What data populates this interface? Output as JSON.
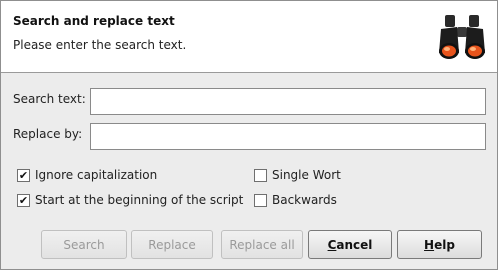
{
  "dialog": {
    "title": "Search and replace text",
    "subtitle": "Please enter the search text.",
    "header_icon": "binoculars-icon"
  },
  "form": {
    "search_label": "Search text:",
    "search_value": "",
    "replace_label": "Replace by:",
    "replace_value": ""
  },
  "options": {
    "ignore_capitalization": {
      "label": "Ignore capitalization",
      "checked": true
    },
    "start_beginning": {
      "label": "Start at the beginning of the script",
      "checked": true
    },
    "single_word": {
      "label": "Single Wort",
      "checked": false
    },
    "backwards": {
      "label": "Backwards",
      "checked": false
    }
  },
  "buttons": {
    "search": "Search",
    "replace": "Replace",
    "replace_all": "Replace all",
    "cancel_first": "C",
    "cancel_rest": "ancel",
    "help_first": "H",
    "help_rest": "elp"
  },
  "checkmark": "✔"
}
